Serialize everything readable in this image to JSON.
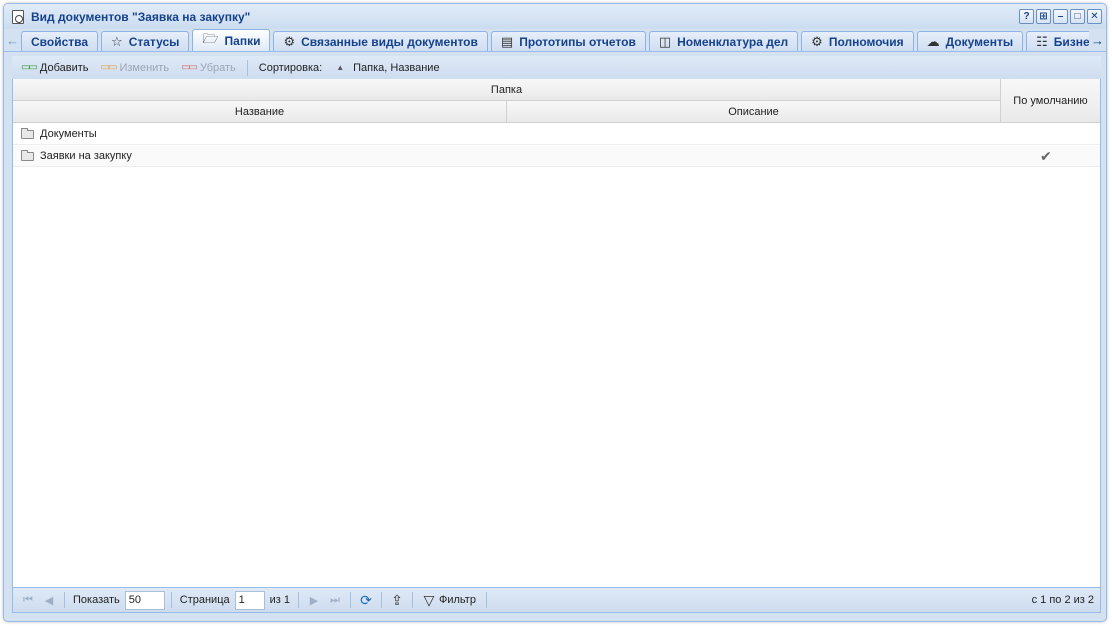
{
  "window": {
    "title": "Вид документов \"Заявка на закупку\"",
    "tools": [
      "?",
      "⊞",
      "–",
      "□",
      "✕"
    ]
  },
  "tabs": [
    {
      "label": "Свойства",
      "icon": "none",
      "active": false
    },
    {
      "label": "Статусы",
      "icon": "star-icon",
      "active": false
    },
    {
      "label": "Папки",
      "icon": "folder-icon",
      "active": true
    },
    {
      "label": "Связанные виды документов",
      "icon": "gear-document-icon",
      "active": false
    },
    {
      "label": "Прототипы отчетов",
      "icon": "report-icon",
      "active": false
    },
    {
      "label": "Номенклатура дел",
      "icon": "register-icon",
      "active": false
    },
    {
      "label": "Полномочия",
      "icon": "user-key-icon",
      "active": false
    },
    {
      "label": "Документы",
      "icon": "documents-cloud-icon",
      "active": false
    },
    {
      "label": "Бизнес-",
      "icon": "org-chart-icon",
      "active": false
    }
  ],
  "toolbar": {
    "add_label": "Добавить",
    "edit_label": "Изменить",
    "remove_label": "Убрать",
    "sort_label": "Сортировка:",
    "sort_value": "Папка, Название"
  },
  "grid": {
    "group_header": "Папка",
    "col_name": "Название",
    "col_description": "Описание",
    "col_default": "По умолчанию",
    "rows": [
      {
        "name": "Документы",
        "description": "",
        "default": false
      },
      {
        "name": "Заявки на закупку",
        "description": "",
        "default": true
      }
    ],
    "check_glyph": "✔"
  },
  "pager": {
    "show_label": "Показать",
    "page_size": "50",
    "page_label": "Страница",
    "page_value": "1",
    "of_label": "из 1",
    "filter_label": "Фильтр",
    "info": "с 1 по 2 из 2"
  },
  "colors": {
    "accent": "#15428b",
    "frame": "#99bbe8",
    "toolbar_bg": "#d3e1f1"
  }
}
